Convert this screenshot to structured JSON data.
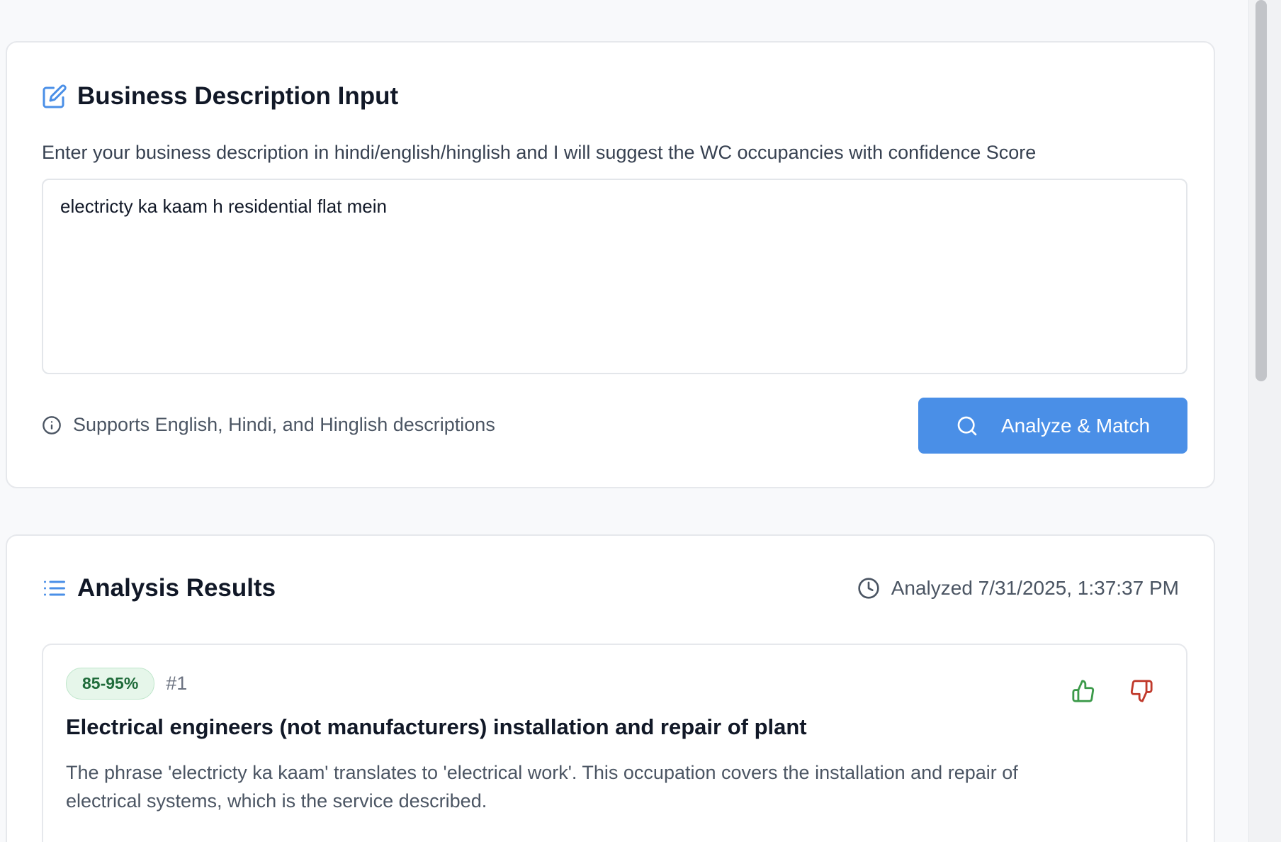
{
  "input_card": {
    "title": "Business Description Input",
    "title_icon": "edit-icon",
    "subtitle": "Enter your business description in hindi/english/hinglish and I will suggest the WC occupancies with confidence Score",
    "textarea_value": "electricty ka kaam h residential flat mein",
    "hint_icon": "info-icon",
    "hint": "Supports English, Hindi, and Hinglish descriptions",
    "analyze_button": {
      "icon": "search-icon",
      "label": "Analyze & Match"
    }
  },
  "results_card": {
    "title": "Analysis Results",
    "title_icon": "list-icon",
    "timestamp_icon": "clock-icon",
    "timestamp": "Analyzed 7/31/2025, 1:37:37 PM",
    "results": [
      {
        "confidence": "85-95%",
        "rank": "#1",
        "title": "Electrical engineers (not manufacturers) installation and repair of plant",
        "description": "The phrase 'electricty ka kaam' translates to 'electrical work'. This occupation covers the installation and repair of electrical systems, which is the service described.",
        "like_icon": "thumbs-up-icon",
        "dislike_icon": "thumbs-down-icon"
      }
    ]
  },
  "colors": {
    "accent": "#4a8fe7",
    "badge_bg": "#e6f6ea",
    "badge_text": "#1f6b3a",
    "thumbs_up": "#3c9a4a",
    "thumbs_down": "#c0392b"
  }
}
